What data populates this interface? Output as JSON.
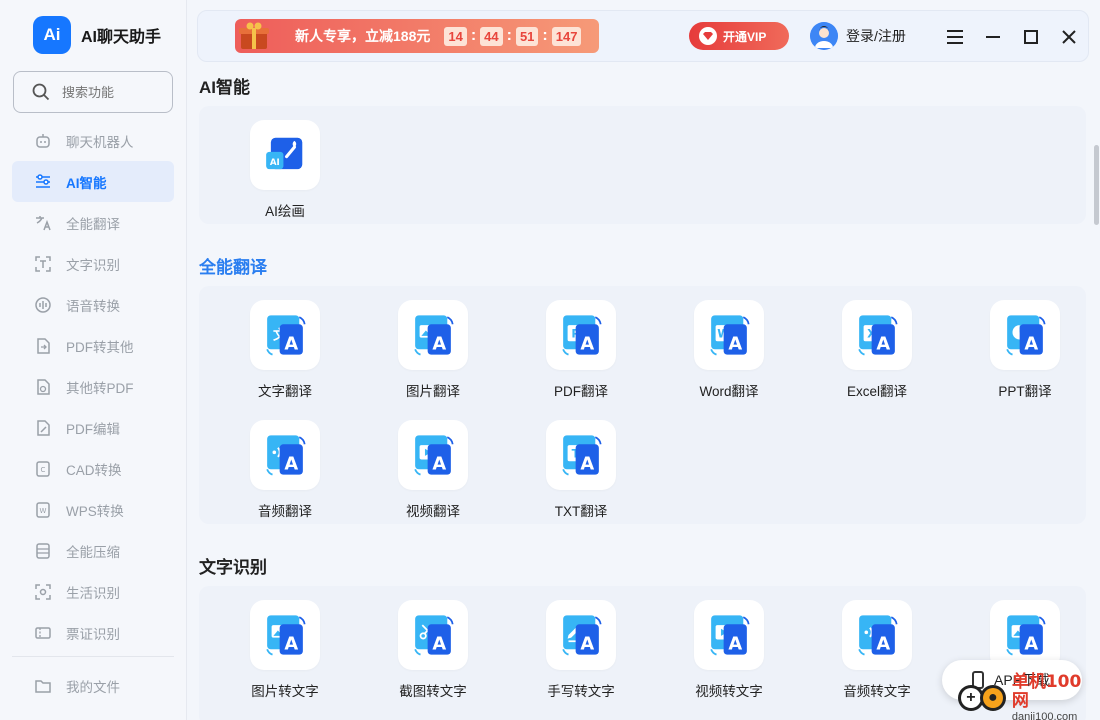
{
  "app": {
    "logo": "Ai",
    "name": "AI聊天助手"
  },
  "search": {
    "placeholder": "搜索功能"
  },
  "sidebar": {
    "items": [
      {
        "label": "聊天机器人",
        "icon": "robot-icon"
      },
      {
        "label": "AI智能",
        "icon": "ai-sliders-icon",
        "active": true
      },
      {
        "label": "全能翻译",
        "icon": "translate-icon"
      },
      {
        "label": "文字识别",
        "icon": "scan-text-icon"
      },
      {
        "label": "语音转换",
        "icon": "voice-icon"
      },
      {
        "label": "PDF转其他",
        "icon": "pdf-convert-icon"
      },
      {
        "label": "其他转PDF",
        "icon": "to-pdf-icon"
      },
      {
        "label": "PDF编辑",
        "icon": "pdf-edit-icon"
      },
      {
        "label": "CAD转换",
        "icon": "cad-icon"
      },
      {
        "label": "WPS转换",
        "icon": "wps-icon"
      },
      {
        "label": "全能压缩",
        "icon": "compress-icon"
      },
      {
        "label": "生活识别",
        "icon": "life-scan-icon"
      },
      {
        "label": "票证识别",
        "icon": "ticket-icon"
      }
    ],
    "bottom": {
      "label": "我的文件",
      "icon": "folder-icon"
    }
  },
  "topbar": {
    "promo_text": "新人专享，立减188元",
    "countdown": {
      "h": "14",
      "m": "44",
      "s": "51",
      "ms": "147"
    },
    "vip_label": "开通VIP",
    "login_label": "登录/注册"
  },
  "sections": {
    "ai": {
      "title": "AI智能",
      "tiles": [
        {
          "label": "AI绘画",
          "glyph": "AI"
        }
      ]
    },
    "translate": {
      "title": "全能翻译",
      "tiles": [
        {
          "label": "文字翻译",
          "glyph": "文"
        },
        {
          "label": "图片翻译",
          "glyph": "img"
        },
        {
          "label": "PDF翻译",
          "glyph": "P"
        },
        {
          "label": "Word翻译",
          "glyph": "W"
        },
        {
          "label": "Excel翻译",
          "glyph": "X"
        },
        {
          "label": "PPT翻译",
          "glyph": "pie"
        },
        {
          "label": "音频翻译",
          "glyph": "audio"
        },
        {
          "label": "视频翻译",
          "glyph": "play"
        },
        {
          "label": "TXT翻译",
          "glyph": "T"
        }
      ]
    },
    "ocr": {
      "title": "文字识别",
      "tiles": [
        {
          "label": "图片转文字",
          "glyph": "img"
        },
        {
          "label": "截图转文字",
          "glyph": "cut"
        },
        {
          "label": "手写转文字",
          "glyph": "pen"
        },
        {
          "label": "视频转文字",
          "glyph": "play"
        },
        {
          "label": "音频转文字",
          "glyph": "audio"
        },
        {
          "label": "",
          "glyph": "img"
        }
      ]
    }
  },
  "app_download": {
    "label": "APP下载"
  },
  "watermark": {
    "cn": "单机100网",
    "en": "danji100.com"
  },
  "colors": {
    "accent": "#1677ff",
    "promo": "#ee5d5a",
    "vip": "#e63b3b"
  }
}
